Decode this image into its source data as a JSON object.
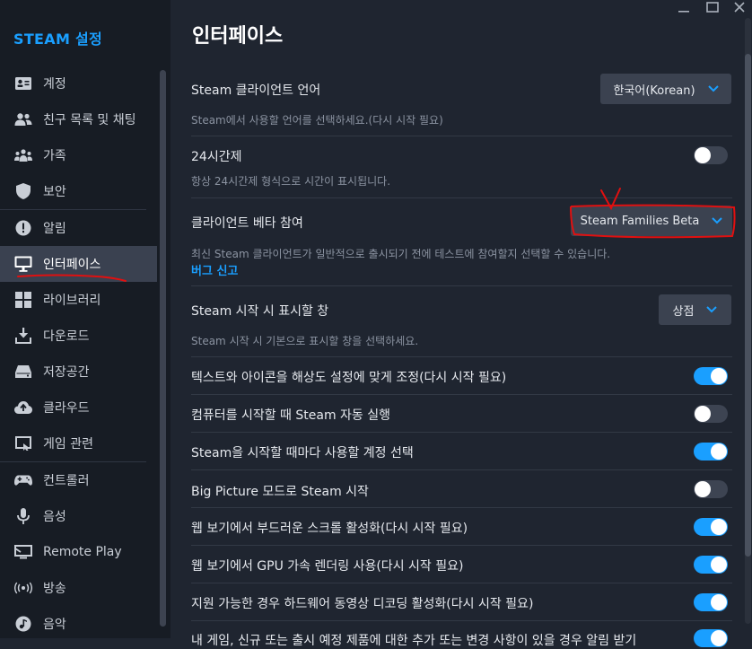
{
  "app_title": "STEAM 설정",
  "page_title": "인터페이스",
  "sidebar": {
    "items": [
      {
        "label": "계정",
        "icon": "id-card-icon"
      },
      {
        "label": "친구 목록 및 채팅",
        "icon": "friends-icon"
      },
      {
        "label": "가족",
        "icon": "family-icon"
      },
      {
        "label": "보안",
        "icon": "shield-icon"
      },
      {
        "label": "알림",
        "icon": "alert-icon"
      },
      {
        "label": "인터페이스",
        "icon": "monitor-icon",
        "active": true
      },
      {
        "label": "라이브러리",
        "icon": "grid-icon"
      },
      {
        "label": "다운로드",
        "icon": "download-icon"
      },
      {
        "label": "저장공간",
        "icon": "drive-icon"
      },
      {
        "label": "클라우드",
        "icon": "cloud-icon"
      },
      {
        "label": "게임 관련",
        "icon": "game-window-icon"
      },
      {
        "label": "컨트롤러",
        "icon": "controller-icon"
      },
      {
        "label": "음성",
        "icon": "microphone-icon"
      },
      {
        "label": "Remote Play",
        "icon": "remote-play-icon"
      },
      {
        "label": "방송",
        "icon": "broadcast-icon"
      },
      {
        "label": "음악",
        "icon": "music-icon"
      }
    ]
  },
  "settings": {
    "language": {
      "label": "Steam 클라이언트 언어",
      "value": "한국어(Korean)",
      "desc": "Steam에서 사용할 언어를 선택하세요.(다시 시작 필요)"
    },
    "clock24": {
      "label": "24시간제",
      "desc": "항상 24시간제 형식으로 시간이 표시됩니다.",
      "on": false
    },
    "beta": {
      "label": "클라이언트 베타 참여",
      "value": "Steam Families Beta",
      "desc": "최신 Steam 클라이언트가 일반적으로 출시되기 전에 테스트에 참여할지 선택할 수 있습니다.",
      "link": "버그 신고"
    },
    "startwindow": {
      "label": "Steam 시작 시 표시할 창",
      "value": "상점",
      "desc": "Steam 시작 시 기본으로 표시할 창을 선택하세요."
    },
    "toggles": [
      {
        "label": "텍스트와 아이콘을 해상도 설정에 맞게 조정(다시 시작 필요)",
        "on": true
      },
      {
        "label": "컴퓨터를 시작할 때 Steam 자동 실행",
        "on": false
      },
      {
        "label": "Steam을 시작할 때마다 사용할 계정 선택",
        "on": true
      },
      {
        "label": "Big Picture 모드로 Steam 시작",
        "on": false
      },
      {
        "label": "웹 보기에서 부드러운 스크롤 활성화(다시 시작 필요)",
        "on": true
      },
      {
        "label": "웹 보기에서 GPU 가속 렌더링 사용(다시 시작 필요)",
        "on": true
      },
      {
        "label": "지원 가능한 경우 하드웨어 동영상 디코딩 활성화(다시 시작 필요)",
        "on": true
      },
      {
        "label": "내 게임, 신규 또는 출시 예정 제품에 대한 추가 또는 변경 사항이 있을 경우 알림 받기",
        "on": true
      }
    ]
  },
  "colors": {
    "accent": "#1a9fff",
    "annotation_red": "#e01010",
    "sidebar_bg": "#171c24",
    "main_bg": "#1f2530"
  }
}
